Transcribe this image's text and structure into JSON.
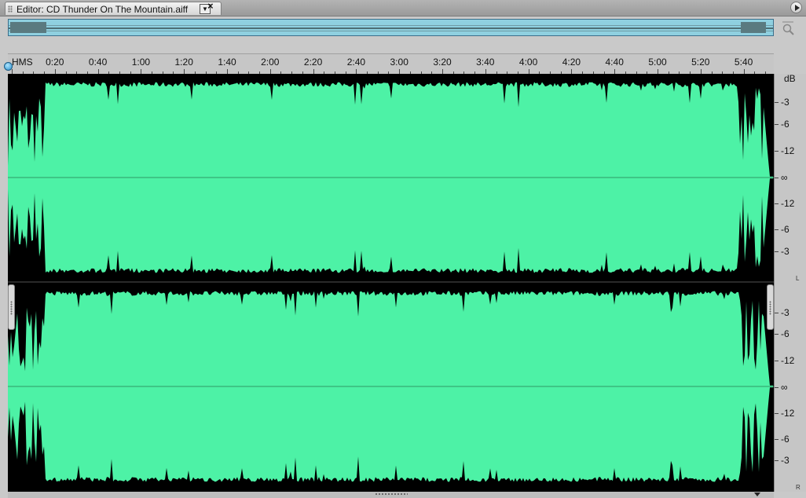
{
  "editor": {
    "tab_title": "Editor: CD Thunder On The Mountain.aiff",
    "dropdown_glyph": "▼",
    "close_glyph": "×",
    "panel_menu_icon": "circle-arrow-icon"
  },
  "overview": {
    "zoom_icon": "zoom-icon"
  },
  "ruler": {
    "units_label": "HMS",
    "labels": [
      "0:20",
      "0:40",
      "1:00",
      "1:20",
      "1:40",
      "2:00",
      "2:20",
      "2:40",
      "3:00",
      "3:20",
      "3:40",
      "4:00",
      "4:20",
      "4:40",
      "5:00",
      "5:20",
      "5:40"
    ]
  },
  "db_scale": {
    "unit_label": "dB",
    "left_channel_labels": [
      "-3",
      "-6",
      "-12",
      "∞",
      "-12",
      "-6",
      "-3"
    ],
    "right_channel_labels": [
      "-3",
      "-6",
      "-12",
      "∞",
      "-12",
      "-6",
      "-3"
    ],
    "left_channel_marker": "L",
    "right_channel_marker": "R"
  },
  "colors": {
    "waveform": "#4df2a6",
    "background": "#000000",
    "center_line": "#2f9a66"
  }
}
